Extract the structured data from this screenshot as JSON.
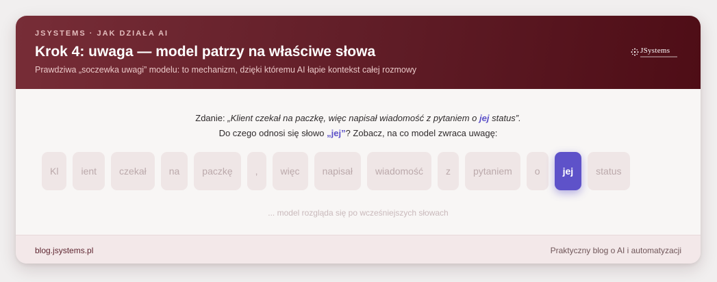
{
  "header": {
    "eyebrow": "JSYSTEMS · JAK DZIAŁA AI",
    "title": "Krok 4: uwaga — model patrzy na właściwe słowa",
    "subtitle": "Prawdziwa „soczewka uwagi” modelu: to mechanizm, dzięki któremu AI łapie kontekst całej rozmowy",
    "logo_text": "JSystems"
  },
  "content": {
    "line1_prefix": "Zdanie: ",
    "line1_quote_start": "„Klient czekał na paczkę, więc napisał wiadomość z pytaniem o ",
    "line1_highlight": "jej",
    "line1_quote_end": " status”.",
    "line2_prefix": "Do czego odnosi się słowo ",
    "line2_highlight": "„jej”",
    "line2_suffix": "? Zobacz, na co model zwraca uwagę:",
    "tokens": [
      {
        "text": "Kl",
        "active": false
      },
      {
        "text": "ient",
        "active": false
      },
      {
        "text": "czekał",
        "active": false
      },
      {
        "text": "na",
        "active": false
      },
      {
        "text": "paczkę",
        "active": false
      },
      {
        "text": ",",
        "active": false
      },
      {
        "text": "więc",
        "active": false
      },
      {
        "text": "napisał",
        "active": false
      },
      {
        "text": "wiadomość",
        "active": false
      },
      {
        "text": "z",
        "active": false
      },
      {
        "text": "pytaniem",
        "active": false
      },
      {
        "text": "o",
        "active": false
      },
      {
        "text": "jej",
        "active": true
      },
      {
        "text": "status",
        "active": false
      }
    ],
    "hint": "... model rozgląda się po wcześniejszych słowach"
  },
  "footer": {
    "left": "blog.jsystems.pl",
    "right": "Praktyczny blog o AI i automatyzacji"
  },
  "colors": {
    "header_start": "#772d37",
    "header_end": "#4e0d16",
    "accent": "#5e52c9",
    "token_bg": "#efe6e6"
  }
}
